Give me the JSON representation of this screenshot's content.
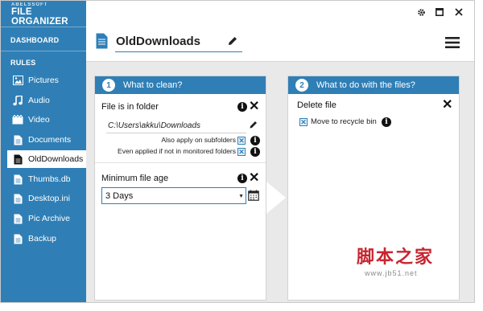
{
  "app": {
    "brand_small": "ABELSSOFT",
    "brand": "FILE ORGANIZER"
  },
  "sidebar": {
    "dashboard_label": "DASHBOARD",
    "rules_label": "RULES",
    "items": [
      {
        "label": "Pictures",
        "icon": "picture-icon"
      },
      {
        "label": "Audio",
        "icon": "music-note-icon"
      },
      {
        "label": "Video",
        "icon": "video-icon"
      },
      {
        "label": "Documents",
        "icon": "document-icon"
      },
      {
        "label": "OldDownloads",
        "icon": "document-icon",
        "active": true
      },
      {
        "label": "Thumbs.db",
        "icon": "document-icon"
      },
      {
        "label": "Desktop.ini",
        "icon": "document-icon"
      },
      {
        "label": "Pic Archive",
        "icon": "document-icon"
      },
      {
        "label": "Backup",
        "icon": "document-icon"
      }
    ]
  },
  "header": {
    "rule_name": "OldDownloads"
  },
  "card1": {
    "step": "1",
    "title": "What to clean?",
    "folder": {
      "title": "File is in folder",
      "path": "C:\\Users\\akku\\Downloads",
      "subfolders_label": "Also apply on subfolders",
      "monitored_label": "Even applied if not in monitored folders"
    },
    "age": {
      "title": "Minimum file age",
      "value": "3 Days"
    }
  },
  "card2": {
    "step": "2",
    "title": "What to do with the files?",
    "action": {
      "title": "Delete file",
      "recycle_label": "Move to recycle bin"
    }
  },
  "watermark": {
    "cn": "脚本之家",
    "url": "www.jb51.net"
  },
  "colors": {
    "accent": "#2f7fb6",
    "watermark": "#c8252f"
  }
}
